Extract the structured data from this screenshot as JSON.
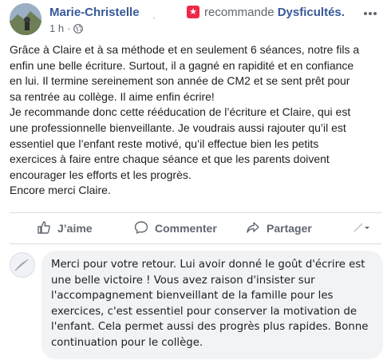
{
  "post": {
    "author": "Marie-Christelle",
    "author_suffix": "ˏ",
    "recommends_icon": "star-icon",
    "recommends_text": "recommande",
    "page_name": "Dysficultés.",
    "time": "1 h",
    "dot": "·",
    "privacy_icon": "globe-icon",
    "more_icon": "more-options-icon",
    "body_lines": [
      "Grâce à Claire et à sa méthode et en seulement 6 séances, notre fils a",
      "enfin une belle écriture. Surtout, il a gagné en rapidité et en confiance",
      "en lui. Il termine sereinement son année de CM2 et se sent prêt pour",
      "sa rentrée au collège. Il aime enfin écrire!",
      "Je recommande donc cette rééducation de l’écriture et Claire, qui est",
      "une professionnelle bienveillante. Je voudrais aussi rajouter qu’il est",
      "essentiel que l’enfant reste motivé, qu’il effectue bien les petits",
      "exercices à faire entre chaque séance et que les parents doivent",
      "encourager les efforts et les progrès.",
      "Encore merci Claire."
    ]
  },
  "actions": {
    "like_label": "J’aime",
    "comment_label": "Commenter",
    "share_label": "Partager"
  },
  "comment": {
    "lines": [
      "Merci pour votre retour. Lui avoir donné le goût d'écrire est",
      "une belle victoire ! Vous avez raison d'insister sur",
      "l'accompagnement bienveillant de la famille pour les",
      "exercices, c'est essentiel pour conserver la motivation de",
      "l'enfant. Cela permet aussi des progrès plus rapides. Bonne",
      "continuation pour le collège."
    ]
  },
  "colors": {
    "link_blue": "#385898",
    "recommend_red": "#f02849",
    "secondary_text": "#606770",
    "bubble_bg": "#f2f3f5"
  }
}
